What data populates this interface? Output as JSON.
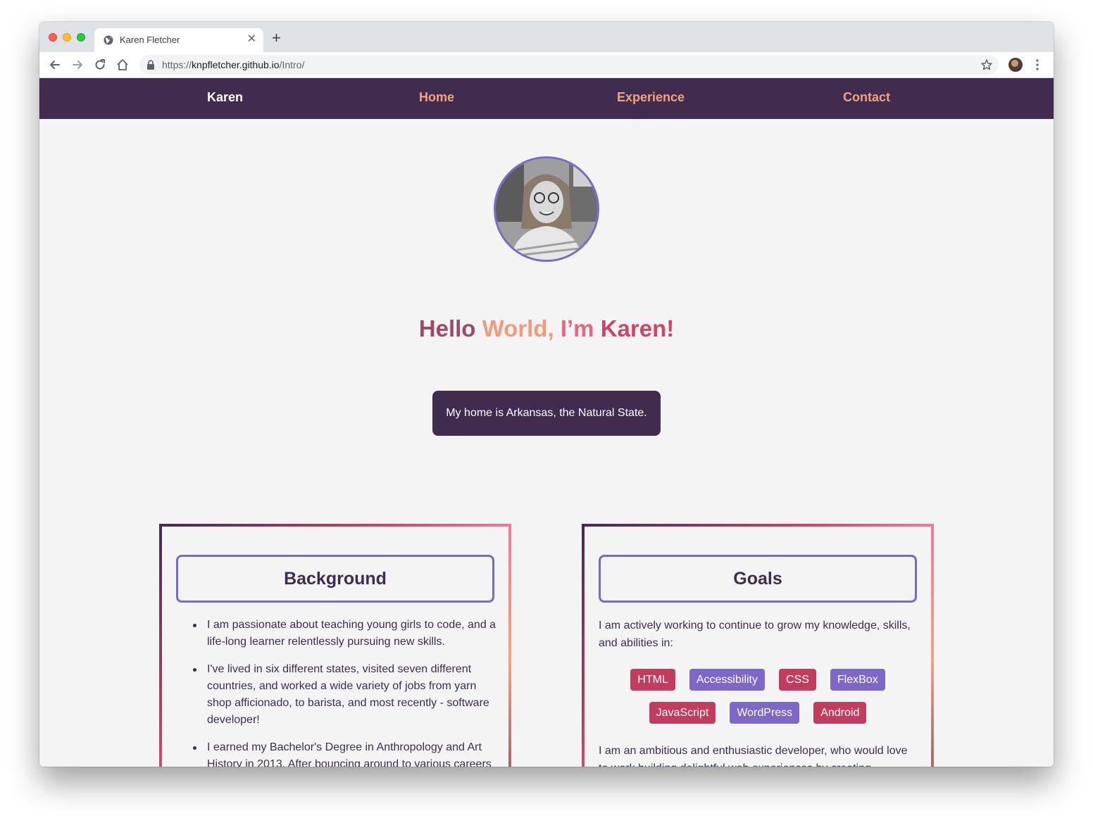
{
  "browser": {
    "tab_title": "Karen Fletcher",
    "url_prefix": "https://",
    "url_host": "knpfletcher.github.io",
    "url_path": "/Intro/"
  },
  "nav": {
    "brand": "Karen",
    "home": "Home",
    "experience": "Experience",
    "contact": "Contact"
  },
  "hero": {
    "title_words": [
      "Hello",
      "World,",
      "I’m",
      "Karen!"
    ],
    "home_text": "My home is Arkansas, the Natural State."
  },
  "background": {
    "heading": "Background",
    "items": [
      "I am passionate about teaching young girls to code, and a life-long learner relentlessly pursuing new skills.",
      "I've lived in six different states, visited seven different countries, and worked a wide variety of jobs from yarn shop afficionado, to barista, and most recently - software developer!",
      "I earned my Bachelor's Degree in Anthropology and Art History in 2013. After bouncing around to various careers"
    ]
  },
  "goals": {
    "heading": "Goals",
    "intro": "I am actively working to continue to grow my knowledge, skills, and abilities in:",
    "tags_row1": [
      "HTML",
      "Accessibility",
      "CSS",
      "FlexBox"
    ],
    "tags_row2": [
      "JavaScript",
      "WordPress",
      "Android"
    ],
    "outro": "I am an ambitious and enthusiastic developer, who would love to work building delightful web experiences by creating"
  },
  "colors": {
    "nav_bg": "#3f2c4f",
    "nav_link": "#f4a37c",
    "accent_purple": "#7b68c8",
    "accent_red": "#c23c5e",
    "page_bg": "#f4f4f5"
  },
  "icons": [
    "globe-icon",
    "close-icon",
    "plus-icon",
    "back-icon",
    "forward-icon",
    "reload-icon",
    "home-icon",
    "lock-icon",
    "star-icon",
    "profile-avatar",
    "more-icon"
  ]
}
